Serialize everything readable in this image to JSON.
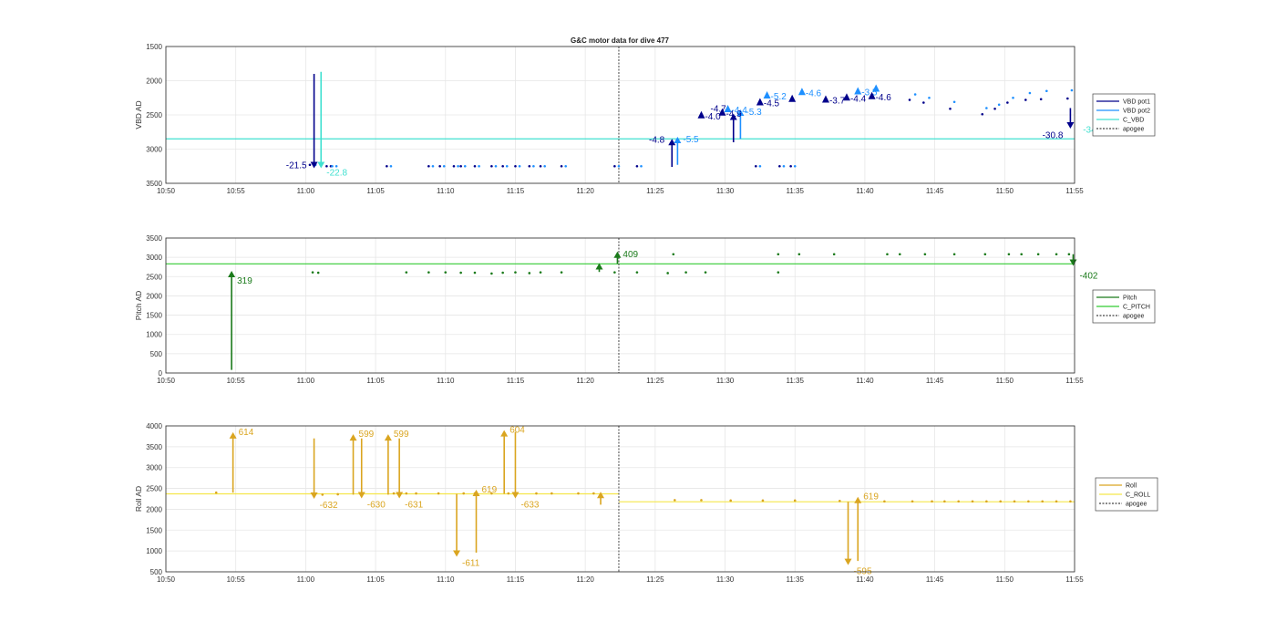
{
  "title": "G&C motor data for dive 477",
  "x_ticks": [
    "10:50",
    "10:55",
    "11:00",
    "11:05",
    "11:10",
    "11:15",
    "11:20",
    "11:25",
    "11:30",
    "11:35",
    "11:40",
    "11:45",
    "11:50",
    "11:55"
  ],
  "colors": {
    "vbd1": "#00008b",
    "vbd2": "#1e90ff",
    "cvbd": "#40e0d0",
    "pitch": "#1a7a1a",
    "cpitch": "#33cc33",
    "roll": "#daa520",
    "croll": "#f5e64a",
    "apogee": "#444444"
  },
  "chart_data": [
    {
      "type": "line",
      "id": "vbd",
      "xlim": [
        0,
        65
      ],
      "x_unit": "minutes after 10:50",
      "ylabel": "VBD AD",
      "ylim": [
        1500,
        3500
      ],
      "y_reversed": true,
      "y_ticks": [
        "1500",
        "2000",
        "2500",
        "3000",
        "3500"
      ],
      "hline": 2850,
      "apogee_x": 32.4,
      "legend": [
        "VBD pot1",
        "VBD pot2",
        "C_VBD",
        "apogee"
      ],
      "series": [
        {
          "name": "VBD pot1",
          "color_key": "vbd1",
          "x": [
            10.3,
            11.5,
            11.8,
            15.8,
            18.8,
            19.6,
            20.6,
            21.1,
            22.1,
            23.3,
            24.1,
            25.0,
            26.0,
            26.8,
            28.3,
            32.1,
            33.7,
            42.2,
            43.9,
            44.7
          ],
          "y": [
            3230,
            3250,
            3250,
            3250,
            3250,
            3250,
            3250,
            3250,
            3250,
            3250,
            3250,
            3250,
            3250,
            3250,
            3250,
            3250,
            3250,
            3250,
            3250,
            3250
          ]
        },
        {
          "name": "VBD pot2",
          "color_key": "vbd2",
          "x": [
            10.7,
            11.9,
            12.2,
            16.1,
            19.1,
            19.9,
            20.9,
            21.4,
            22.4,
            23.6,
            24.4,
            25.3,
            26.3,
            27.1,
            28.6,
            32.4,
            34.0,
            42.5,
            44.2,
            45.0
          ],
          "y": [
            3230,
            3250,
            3250,
            3250,
            3250,
            3250,
            3250,
            3250,
            3250,
            3250,
            3250,
            3250,
            3250,
            3250,
            3250,
            3250,
            3250,
            3250,
            3250,
            3250
          ]
        },
        {
          "name": "VBD pot1",
          "color_key": "vbd1",
          "x": [
            53.2,
            54.2,
            56.1,
            58.4,
            59.3,
            60.2,
            61.5,
            62.6,
            64.5,
            65.2,
            66.3,
            67.1,
            68.7,
            70.3,
            71.3,
            72.3,
            73.3,
            74.3,
            75.3,
            76.3,
            77.3,
            78.3,
            79.3,
            80.3,
            81.3,
            82.3,
            83.3,
            84.3
          ],
          "y": [
            2280,
            2320,
            2410,
            2490,
            2410,
            2320,
            2280,
            2270,
            2260,
            2230,
            2210,
            2210,
            2210,
            2210,
            2210,
            2210,
            2210,
            2210,
            2210,
            2210,
            2210,
            2210,
            2210,
            2210,
            2210,
            2210,
            2210,
            2210
          ]
        },
        {
          "name": "VBD pot2",
          "color_key": "vbd2",
          "x": [
            53.6,
            54.6,
            56.4,
            58.7,
            59.6,
            60.6,
            61.8,
            63.0,
            64.8,
            65.6,
            66.6,
            67.5,
            69.1,
            70.6,
            71.6,
            72.6,
            73.6,
            74.6,
            75.6,
            76.6,
            77.6,
            78.6,
            79.6,
            80.6,
            81.6,
            82.6,
            83.6,
            84.6
          ],
          "y": [
            2200,
            2250,
            2310,
            2400,
            2350,
            2250,
            2180,
            2150,
            2140,
            2120,
            2110,
            2100,
            2100,
            2100,
            2100,
            2100,
            2100,
            2100,
            2100,
            2100,
            2100,
            2100,
            2100,
            2100,
            2100,
            2100,
            2100,
            2100
          ]
        }
      ],
      "arrows": [
        {
          "x": 10.6,
          "y0": 1900,
          "y1": 3280,
          "color_key": "vbd1",
          "label": "-21.5"
        },
        {
          "x": 11.1,
          "y0": 1870,
          "y1": 3280,
          "color_key": "cvbd",
          "label": "-22.8"
        },
        {
          "x": 36.2,
          "y0": 3260,
          "y1": 2850,
          "color_key": "vbd1",
          "label": "-4.8"
        },
        {
          "x": 36.6,
          "y0": 3230,
          "y1": 2820,
          "color_key": "vbd2",
          "label": "-5.5"
        },
        {
          "x": 40.6,
          "y0": 2900,
          "y1": 2480,
          "color_key": "vbd1",
          "label": "-4.7"
        },
        {
          "x": 41.1,
          "y0": 2850,
          "y1": 2420,
          "color_key": "vbd2",
          "label": "-5.3"
        },
        {
          "x": 64.7,
          "y0": 2400,
          "y1": 2700,
          "color_key": "vbd1",
          "label": "-30.8"
        }
      ],
      "markers": [
        {
          "x": 38.3,
          "y": 2510,
          "color_key": "vbd1",
          "label": "-4.0"
        },
        {
          "x": 39.8,
          "y": 2470,
          "color_key": "vbd1",
          "label": "-4.9"
        },
        {
          "x": 40.2,
          "y": 2420,
          "color_key": "vbd2",
          "label": "-4.4"
        },
        {
          "x": 42.5,
          "y": 2320,
          "color_key": "vbd1",
          "label": "-4.5"
        },
        {
          "x": 43.0,
          "y": 2220,
          "color_key": "vbd2",
          "label": "-5.2"
        },
        {
          "x": 44.8,
          "y": 2270,
          "color_key": "vbd1",
          "label": ""
        },
        {
          "x": 45.5,
          "y": 2170,
          "color_key": "vbd2",
          "label": "-4.6"
        },
        {
          "x": 47.2,
          "y": 2280,
          "color_key": "vbd1",
          "label": "-3.7"
        },
        {
          "x": 48.7,
          "y": 2250,
          "color_key": "vbd1",
          "label": "-4.4"
        },
        {
          "x": 49.5,
          "y": 2160,
          "color_key": "vbd2",
          "label": "-3.5"
        },
        {
          "x": 50.5,
          "y": 2230,
          "color_key": "vbd1",
          "label": "-4.6"
        },
        {
          "x": 50.8,
          "y": 2120,
          "color_key": "vbd2",
          "label": ""
        }
      ],
      "labels": [
        {
          "text": "-34",
          "x": 65.6,
          "y": 2760,
          "color_key": "cvbd"
        }
      ]
    },
    {
      "type": "line",
      "id": "pitch",
      "xlim": [
        0,
        65
      ],
      "ylabel": "Pitch AD",
      "ylim": [
        0,
        3500
      ],
      "y_reversed": false,
      "y_ticks": [
        "0",
        "500",
        "1000",
        "1500",
        "2000",
        "2500",
        "3000",
        "3500"
      ],
      "hline": 2830,
      "apogee_x": 32.4,
      "legend": [
        "Pitch",
        "C_PITCH",
        "apogee"
      ],
      "series": [
        {
          "name": "Pitch",
          "color_key": "pitch",
          "x": [
            10.5,
            10.9,
            17.2,
            18.8,
            20.0,
            21.1,
            22.1,
            23.3,
            24.1,
            25.0,
            26.0,
            26.8,
            28.3,
            32.1,
            33.7,
            35.9,
            37.2,
            38.6,
            43.8
          ],
          "y": [
            2610,
            2600,
            2610,
            2610,
            2610,
            2600,
            2600,
            2580,
            2600,
            2610,
            2590,
            2610,
            2610,
            2610,
            2610,
            2590,
            2610,
            2610,
            2610
          ]
        },
        {
          "name": "Pitch",
          "color_key": "pitch",
          "x": [
            36.3,
            43.8,
            45.3,
            47.8,
            51.6,
            52.5,
            54.3,
            56.4,
            58.6,
            60.3,
            61.2,
            62.4,
            63.7,
            64.6
          ],
          "y": [
            3080,
            3080,
            3080,
            3080,
            3080,
            3080,
            3080,
            3080,
            3080,
            3080,
            3080,
            3080,
            3080,
            3080
          ]
        }
      ],
      "arrows": [
        {
          "x": 4.7,
          "y0": 80,
          "y1": 2650,
          "color_key": "pitch",
          "label": "319"
        },
        {
          "x": 31.0,
          "y0": 2620,
          "y1": 2850,
          "color_key": "pitch",
          "label": ""
        },
        {
          "x": 32.3,
          "y0": 2830,
          "y1": 3150,
          "color_key": "pitch",
          "label": "409"
        },
        {
          "x": 64.9,
          "y0": 3080,
          "y1": 2780,
          "color_key": "pitch",
          "label": "-402"
        }
      ],
      "markers": [],
      "labels": []
    },
    {
      "type": "line",
      "id": "roll",
      "xlim": [
        0,
        65
      ],
      "ylabel": "Roll AD",
      "ylim": [
        500,
        4000
      ],
      "y_reversed": false,
      "y_ticks": [
        "500",
        "1000",
        "1500",
        "2000",
        "2500",
        "3000",
        "3500",
        "4000"
      ],
      "hlines": [
        {
          "x0": 0,
          "x1": 32.4,
          "y": 2370
        },
        {
          "x0": 32.4,
          "x1": 65,
          "y": 2180
        }
      ],
      "apogee_x": 32.4,
      "legend": [
        "Roll",
        "C_ROLL",
        "apogee"
      ],
      "series": [
        {
          "name": "Roll",
          "color_key": "roll",
          "x": [
            3.6,
            11.2,
            12.3,
            14.0,
            16.3,
            17.2,
            17.9,
            19.5,
            21.3,
            22.1,
            23.3,
            24.5,
            25.0,
            26.5,
            27.6,
            29.5,
            30.6
          ],
          "y": [
            2400,
            2350,
            2360,
            2380,
            2380,
            2380,
            2380,
            2380,
            2380,
            2380,
            2380,
            2380,
            2380,
            2380,
            2380,
            2380,
            2380
          ]
        },
        {
          "name": "Roll",
          "color_key": "roll",
          "x": [
            36.4,
            38.3,
            40.4,
            42.7,
            45.0,
            48.2,
            51.4,
            53.4,
            54.8,
            55.7,
            56.7,
            57.7,
            58.7,
            59.7,
            60.7,
            61.7,
            62.7,
            63.7,
            64.7
          ],
          "y": [
            2220,
            2220,
            2210,
            2210,
            2210,
            2200,
            2190,
            2190,
            2190,
            2190,
            2190,
            2190,
            2190,
            2190,
            2190,
            2190,
            2190,
            2190,
            2190
          ]
        }
      ],
      "arrows": [
        {
          "x": 4.8,
          "y0": 2400,
          "y1": 3850,
          "color_key": "roll",
          "label": "614"
        },
        {
          "x": 10.6,
          "y0": 3700,
          "y1": 2250,
          "color_key": "roll",
          "label": "-632"
        },
        {
          "x": 13.4,
          "y0": 2350,
          "y1": 3800,
          "color_key": "roll",
          "label": "599"
        },
        {
          "x": 14.0,
          "y0": 3700,
          "y1": 2260,
          "color_key": "roll",
          "label": "-630"
        },
        {
          "x": 15.9,
          "y0": 2350,
          "y1": 3800,
          "color_key": "roll",
          "label": "599"
        },
        {
          "x": 16.7,
          "y0": 3700,
          "y1": 2260,
          "color_key": "roll",
          "label": "-631"
        },
        {
          "x": 20.8,
          "y0": 2370,
          "y1": 860,
          "color_key": "roll",
          "label": "-611"
        },
        {
          "x": 22.2,
          "y0": 960,
          "y1": 2470,
          "color_key": "roll",
          "label": "619"
        },
        {
          "x": 24.2,
          "y0": 2370,
          "y1": 3900,
          "color_key": "roll",
          "label": "604"
        },
        {
          "x": 25.0,
          "y0": 3850,
          "y1": 2260,
          "color_key": "roll",
          "label": "-633"
        },
        {
          "x": 31.1,
          "y0": 2110,
          "y1": 2420,
          "color_key": "roll",
          "label": ""
        },
        {
          "x": 48.8,
          "y0": 2180,
          "y1": 660,
          "color_key": "roll",
          "label": "-595"
        },
        {
          "x": 49.5,
          "y0": 760,
          "y1": 2300,
          "color_key": "roll",
          "label": "619"
        }
      ],
      "markers": [],
      "labels": []
    }
  ]
}
